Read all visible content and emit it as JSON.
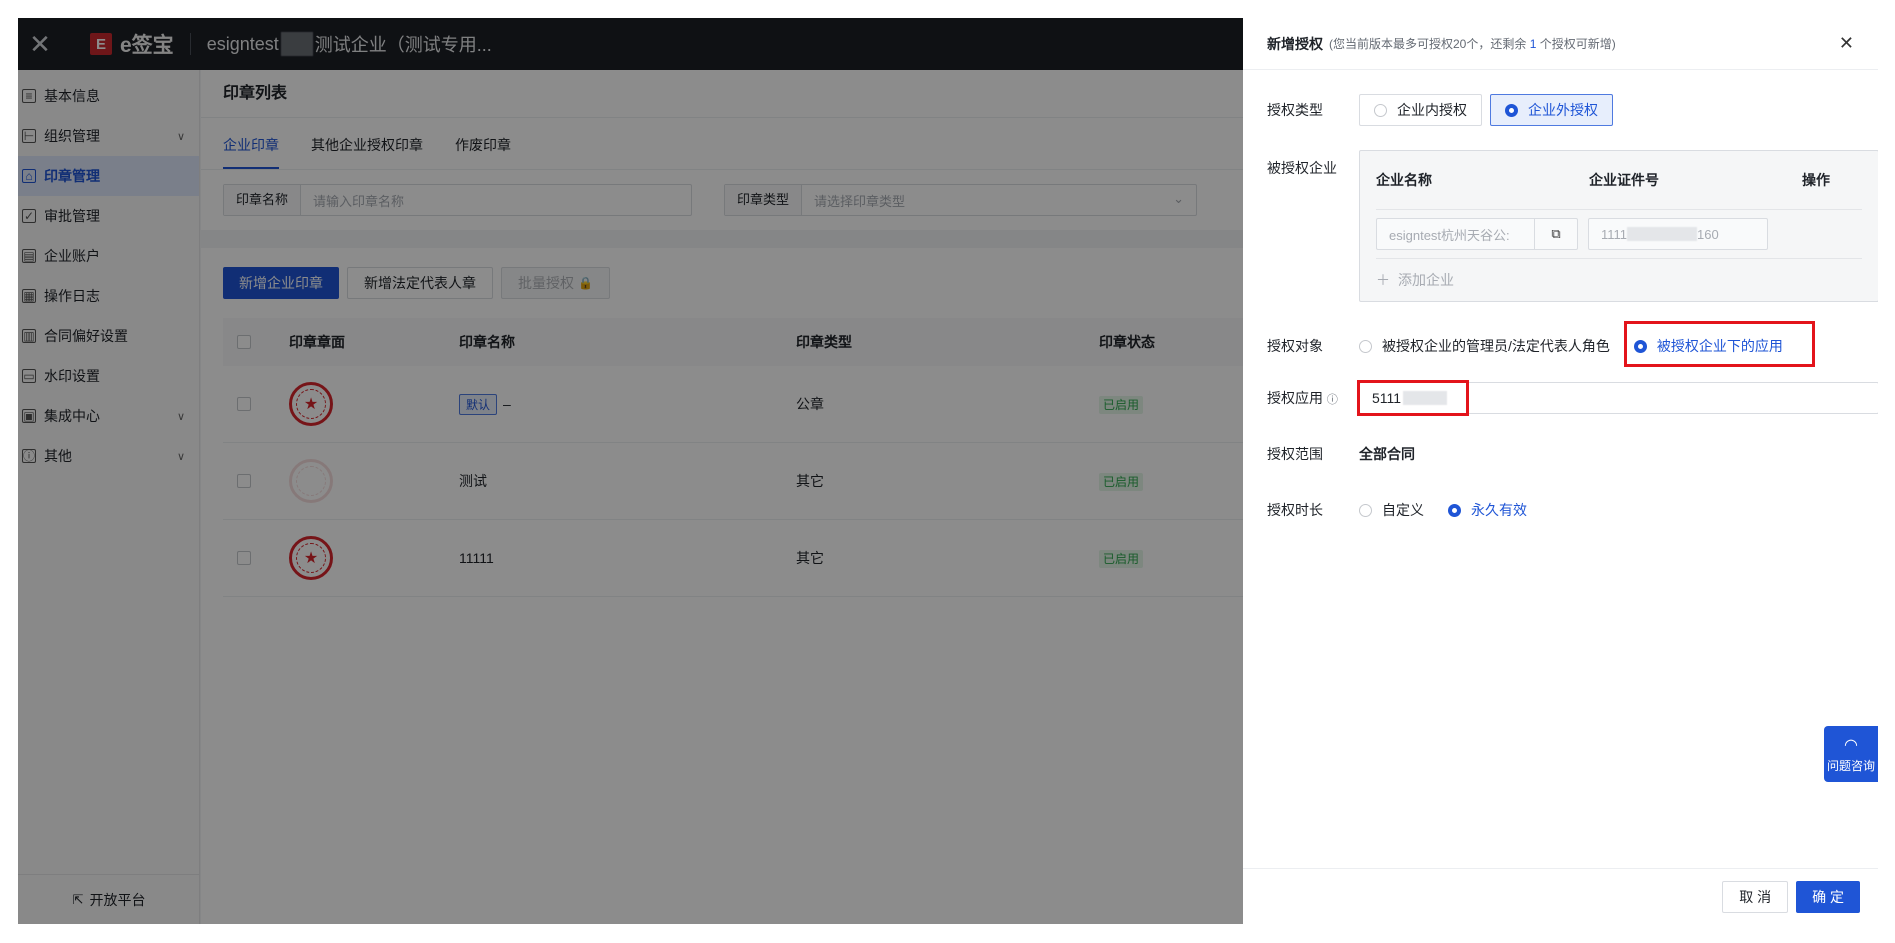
{
  "topbar": {
    "close_glyph": "✕",
    "logo_mark": "E",
    "logo_text": "e签宝",
    "company_prefix": "esigntest",
    "company_suffix": "测试企业（测试专用..."
  },
  "sidebar": {
    "items": [
      {
        "label": "基本信息",
        "icon": "info-card-icon",
        "glyph": "≡"
      },
      {
        "label": "组织管理",
        "icon": "org-tree-icon",
        "glyph": "⊢",
        "has_children": true
      },
      {
        "label": "印章管理",
        "icon": "seal-icon",
        "glyph": "⌂",
        "active": true
      },
      {
        "label": "审批管理",
        "icon": "approval-icon",
        "glyph": "✓"
      },
      {
        "label": "企业账户",
        "icon": "account-icon",
        "glyph": "▤"
      },
      {
        "label": "操作日志",
        "icon": "log-icon",
        "glyph": "▦"
      },
      {
        "label": "合同偏好设置",
        "icon": "contract-setting-icon",
        "glyph": "▥"
      },
      {
        "label": "水印设置",
        "icon": "watermark-icon",
        "glyph": "▭"
      },
      {
        "label": "集成中心",
        "icon": "integration-icon",
        "glyph": "▣",
        "has_children": true
      },
      {
        "label": "其他",
        "icon": "other-icon",
        "glyph": "ⓘ",
        "has_children": true
      }
    ],
    "open_platform": "开放平台"
  },
  "main": {
    "page_title": "印章列表",
    "tabs": [
      "企业印章",
      "其他企业授权印章",
      "作废印章"
    ],
    "filters": {
      "name_label": "印章名称",
      "name_placeholder": "请输入印章名称",
      "type_label": "印章类型",
      "type_placeholder": "请选择印章类型"
    },
    "buttons": {
      "add_company_seal": "新增企业印章",
      "add_legal_seal": "新增法定代表人章",
      "batch_auth": "批量授权"
    },
    "table": {
      "headers": [
        "印章章面",
        "印章名称",
        "印章类型",
        "印章状态"
      ],
      "rows": [
        {
          "badge": "默认",
          "name": "–",
          "type": "公章",
          "status": "已启用"
        },
        {
          "badge": "",
          "name": "测试",
          "type": "其它",
          "status": "已启用"
        },
        {
          "badge": "",
          "name": "11111",
          "type": "其它",
          "status": "已启用"
        }
      ]
    }
  },
  "drawer": {
    "title": "新增授权",
    "subtitle_before": "(您当前版本最多可授权20个，还剩余",
    "subtitle_num": "1",
    "subtitle_after": "个授权可新增)",
    "auth_type_label": "授权类型",
    "auth_type_options": [
      "企业内授权",
      "企业外授权"
    ],
    "authorized_company_label": "被授权企业",
    "panel_headers": [
      "企业名称",
      "企业证件号",
      "操作"
    ],
    "company_name_value": "esigntest杭州天谷公:",
    "cert_prefix": "1111",
    "cert_suffix": "160",
    "add_company": "添加企业",
    "auth_target_label": "授权对象",
    "auth_target_options": [
      "被授权企业的管理员/法定代表人角色",
      "被授权企业下的应用"
    ],
    "auth_app_label": "授权应用",
    "auth_app_value": "5111",
    "auth_scope_label": "授权范围",
    "auth_scope_value": "全部合同",
    "auth_duration_label": "授权时长",
    "auth_duration_options": [
      "自定义",
      "永久有效"
    ],
    "cancel": "取 消",
    "confirm": "确 定"
  },
  "help": {
    "label": "问题咨询"
  },
  "colors": {
    "primary": "#1f55d6",
    "highlight": "#e3141b",
    "seal": "#d8262c"
  }
}
